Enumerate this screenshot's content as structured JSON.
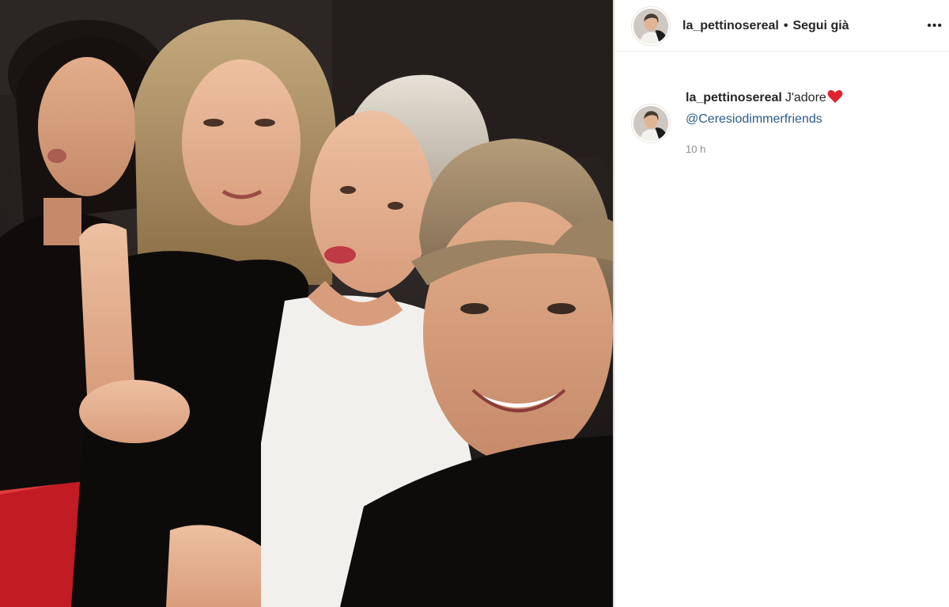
{
  "post": {
    "username": "la_pettinosereal",
    "separator": "•",
    "follow_status": "Segui già",
    "more_label": "•••"
  },
  "caption": {
    "username": "la_pettinosereal",
    "text": "J'adore",
    "mention": "@Ceresiodimmerfriends",
    "time": "10 h",
    "emoji": "heart-icon"
  },
  "photo": {
    "description_icon": "group-selfie-photo"
  },
  "colors": {
    "link": "#2b5a8a",
    "heart": "#e0242f",
    "text": "#262626",
    "muted": "#8e8e8e"
  }
}
